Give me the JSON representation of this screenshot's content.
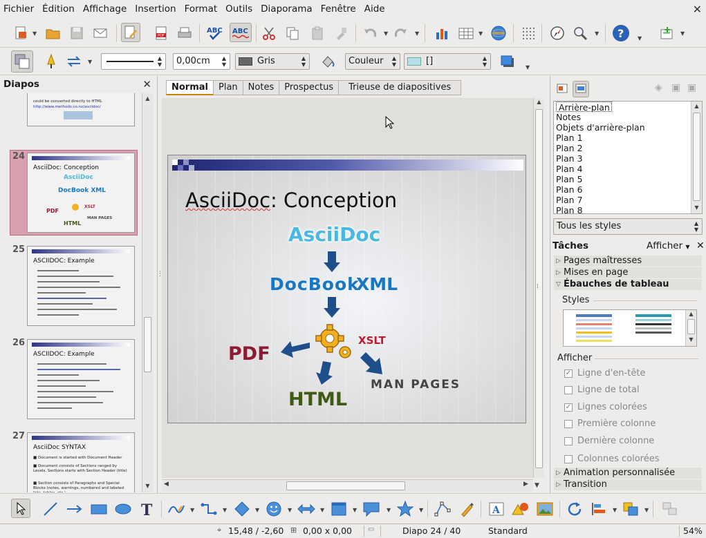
{
  "menubar": {
    "items": [
      "Fichier",
      "Édition",
      "Affichage",
      "Insertion",
      "Format",
      "Outils",
      "Diaporama",
      "Fenêtre",
      "Aide"
    ]
  },
  "toolbar2": {
    "line_width": "0,00cm",
    "color_name": "Gris",
    "fill_type": "Couleur",
    "fill_value": "[]"
  },
  "slide_pane": {
    "title": "Diapos",
    "slides": [
      {
        "num": "24",
        "title": "AsciiDoc: Conception",
        "selected": true
      },
      {
        "num": "25",
        "title": "ASCIIDOC: Example"
      },
      {
        "num": "26",
        "title": "ASCIIDOC: Example"
      },
      {
        "num": "27",
        "title": "AsciiDoc SYNTAX"
      }
    ],
    "top_partial": {
      "lines": [
        "could be converted directly to HTML",
        "http://www.methods.co.nz/asciidoc/"
      ]
    },
    "slide27_bullets": [
      "Document is started with Document Header",
      "Document consists of Sections ranged by Levels. Sections starts with Section Header (title)",
      "Section consists of Paragraphs and Special Blocks (notes, warnings, numbered and labeled lists, tables, etc.)"
    ]
  },
  "tabs": [
    "Normal",
    "Plan",
    "Notes",
    "Prospectus",
    "Trieuse de diapositives"
  ],
  "slide": {
    "title_part1": "AsciiDoc",
    "title_part2": ": Conception",
    "asciidoc": "AsciiDoc",
    "docbook": "DocBook",
    "xml": "XML",
    "xslt": "XSLT",
    "pdf": "PDF",
    "html": "HTML",
    "man_pages": "MAN PAGES"
  },
  "right_panel": {
    "styles": [
      "Arrière-plan",
      "Notes",
      "Objets d'arrière-plan",
      "Plan 1",
      "Plan 2",
      "Plan 3",
      "Plan 4",
      "Plan 5",
      "Plan 6",
      "Plan 7",
      "Plan 8"
    ],
    "style_filter": "Tous les styles",
    "tasks_title": "Tâches",
    "tasks_view": "Afficher",
    "sections": {
      "master_pages": "Pages maîtresses",
      "layouts": "Mises en page",
      "table_design": "Ébauches de tableau",
      "custom_animation": "Animation personnalisée",
      "transition": "Transition"
    },
    "styles_label": "Styles",
    "show_label": "Afficher",
    "checkboxes": [
      {
        "label": "Ligne d'en-tête",
        "checked": true
      },
      {
        "label": "Ligne de total",
        "checked": false
      },
      {
        "label": "Lignes colorées",
        "checked": true
      },
      {
        "label": "Première colonne",
        "checked": false
      },
      {
        "label": "Dernière colonne",
        "checked": false
      },
      {
        "label": "Colonnes colorées",
        "checked": false
      }
    ]
  },
  "status": {
    "position": "15,48 / -2,60",
    "size": "0,00 x 0,00",
    "slide": "Diapo 24 / 40",
    "layout": "Standard",
    "zoom": "54%"
  },
  "colors": {
    "selected_slide_bg": "#d9a0b0",
    "slide_bar": "#2e3585",
    "asciidoc_blue": "#4ab8e0",
    "docbook_blue": "#1877c4",
    "pdf_red": "#8b1a32",
    "html_green": "#3f5a12",
    "xslt_red": "#c01830"
  }
}
